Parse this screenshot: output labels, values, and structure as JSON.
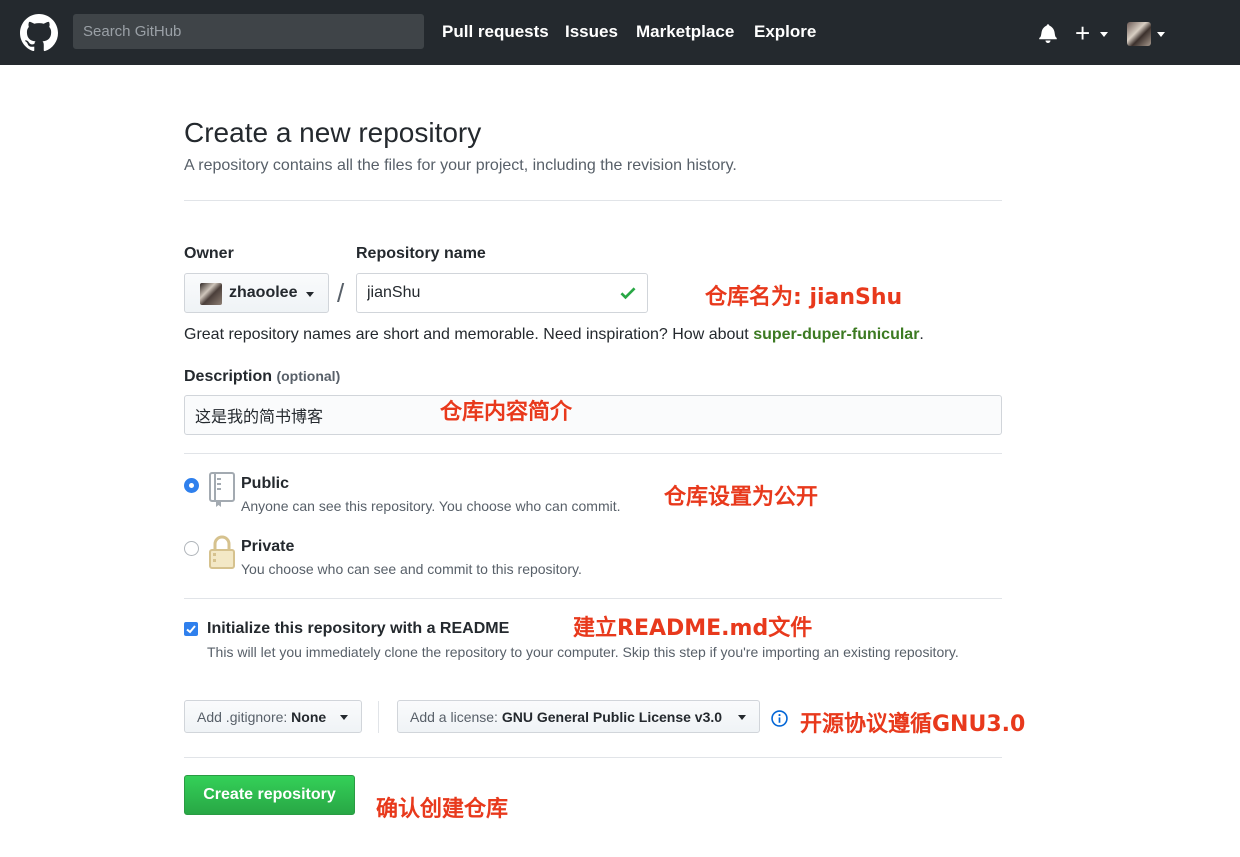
{
  "header": {
    "search_placeholder": "Search GitHub",
    "nav": {
      "pull_requests": "Pull requests",
      "issues": "Issues",
      "marketplace": "Marketplace",
      "explore": "Explore"
    },
    "plus_label": "+"
  },
  "page": {
    "title": "Create a new repository",
    "subtitle": "A repository contains all the files for your project, including the revision history."
  },
  "form": {
    "owner_label": "Owner",
    "owner_value": "zhaoolee",
    "separator": "/",
    "repo_name_label": "Repository name",
    "repo_name_value": "jianShu",
    "hint_text": "Great repository names are short and memorable. Need inspiration? How about ",
    "hint_suggestion": "super-duper-funicular",
    "hint_end": ".",
    "description_label": "Description",
    "description_optional": "(optional)",
    "description_value": "这是我的简书博客",
    "visibility": {
      "public_title": "Public",
      "public_desc": "Anyone can see this repository. You choose who can commit.",
      "private_title": "Private",
      "private_desc": "You choose who can see and commit to this repository.",
      "selected": "Public"
    },
    "init_readme": {
      "checked": true,
      "title": "Initialize this repository with a README",
      "desc": "This will let you immediately clone the repository to your computer. Skip this step if you're importing an existing repository."
    },
    "gitignore_prefix": "Add .gitignore: ",
    "gitignore_value": "None",
    "license_prefix": "Add a license: ",
    "license_value": "GNU General Public License v3.0",
    "submit_label": "Create repository"
  },
  "annotations": {
    "repo_name": "仓库名为: jianShu",
    "description": "仓库内容简介",
    "public": "仓库设置为公开",
    "readme": "建立README.md文件",
    "license": "开源协议遵循GNU3.0",
    "create": "确认创建仓库"
  },
  "colors": {
    "header_bg": "#24292e",
    "accent_green": "#28a745",
    "annotation_red": "#e8391c",
    "link_green": "#3c7a22"
  }
}
